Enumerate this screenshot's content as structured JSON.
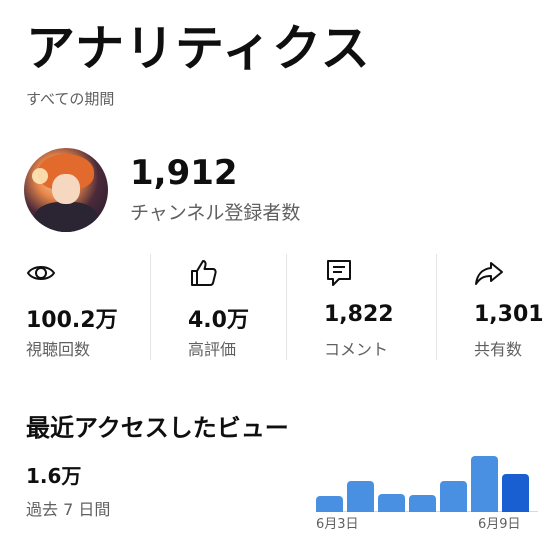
{
  "header": {
    "title": "アナリティクス",
    "subtitle": "すべての期間"
  },
  "channel": {
    "subscriber_count": "1,912",
    "subscriber_label": "チャンネル登録者数"
  },
  "stats": [
    {
      "icon": "eye-icon",
      "value": "100.2万",
      "label": "視聴回数"
    },
    {
      "icon": "thumbs-up-icon",
      "value": "4.0万",
      "label": "高評価"
    },
    {
      "icon": "comment-icon",
      "value": "1,822",
      "label": "コメント"
    },
    {
      "icon": "share-icon",
      "value": "1,301",
      "label": "共有数"
    }
  ],
  "recent": {
    "title": "最近アクセスしたビュー",
    "value": "1.6万",
    "period": "過去 7 日間"
  },
  "chart_data": {
    "type": "bar",
    "categories": [
      "6月3日",
      "",
      "",
      "",
      "",
      "",
      "6月9日"
    ],
    "values": [
      0.28,
      0.55,
      0.32,
      0.3,
      0.55,
      1.0,
      0.68
    ],
    "tick_labels": [
      "6月3日",
      "6月9日"
    ],
    "colors": {
      "normal": "#4a90e2",
      "highlight": "#1a5fd1"
    },
    "grid": false
  }
}
